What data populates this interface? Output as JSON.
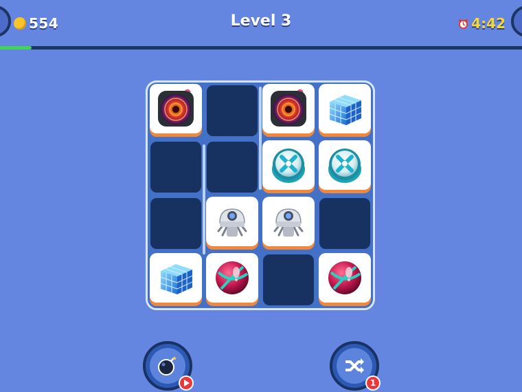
{
  "header": {
    "coins": "554",
    "level_title": "Level 3",
    "timer": "4:42",
    "coin_color": "#f7c52a",
    "timer_color": "#f5d73a"
  },
  "progress": {
    "fraction": 0.06,
    "fill_color": "#3ed455"
  },
  "board": {
    "rows": 4,
    "cols": 4,
    "cells": [
      [
        "speaker",
        null,
        "speaker",
        "cube"
      ],
      [
        null,
        null,
        "x-ball",
        "x-ball"
      ],
      [
        null,
        "robot",
        "robot",
        null
      ],
      [
        "cube",
        "red-ball",
        null,
        "red-ball"
      ]
    ]
  },
  "powerups": {
    "bomb": {
      "icon": "bomb-icon",
      "badge_icon": "play-icon"
    },
    "shuffle": {
      "icon": "shuffle-icon",
      "badge": "1"
    }
  }
}
